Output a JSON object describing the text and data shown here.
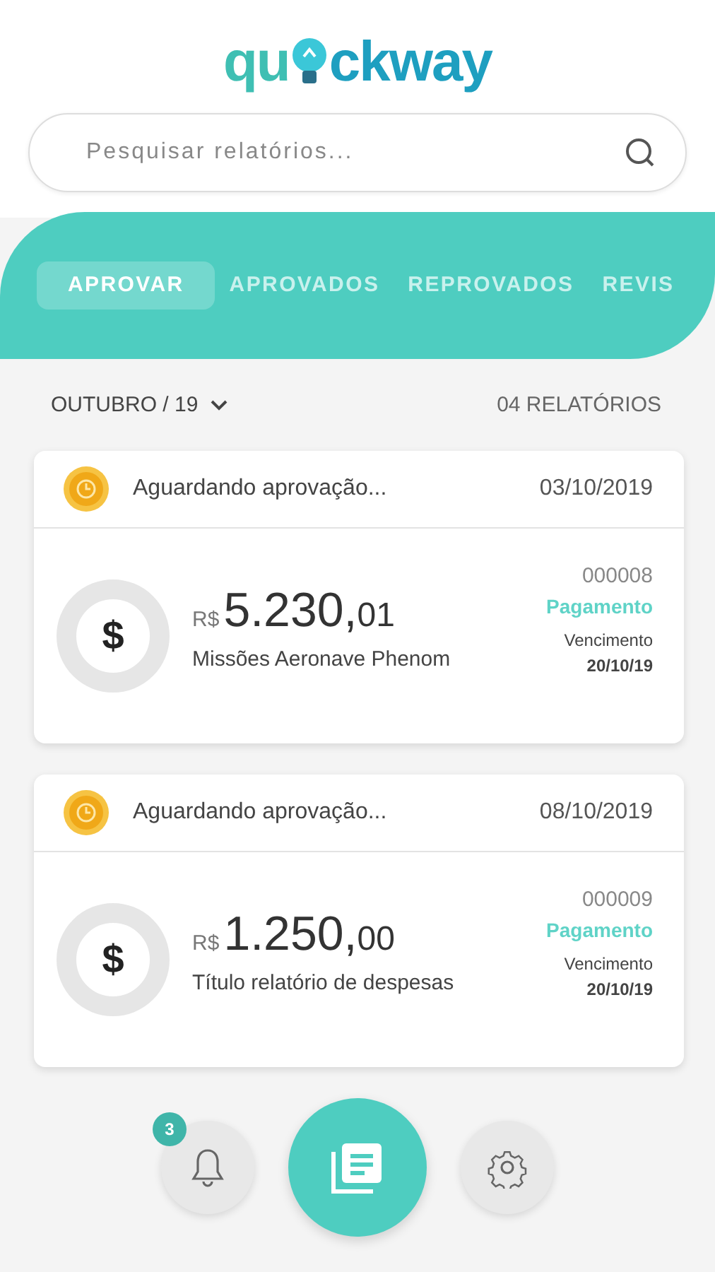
{
  "logo": {
    "before": "qu",
    "after": "ckway"
  },
  "search": {
    "placeholder": "Pesquisar relatórios..."
  },
  "tabs": [
    {
      "label": "APROVAR",
      "selected": true
    },
    {
      "label": "APROVADOS",
      "selected": false
    },
    {
      "label": "REPROVADOS",
      "selected": false
    },
    {
      "label": "REVIS",
      "selected": false
    }
  ],
  "period": "OUTUBRO / 19",
  "count": "04 RELATÓRIOS",
  "reports": [
    {
      "symbol": "$",
      "status": "Aguardando aprovação...",
      "date": "03/10/2019",
      "currency": "R$",
      "amount": "5.230,",
      "cents": "01",
      "title": "Missões Aeronave Phenom",
      "number": "000008",
      "type": "Pagamento",
      "due_label": "Vencimento",
      "due": "20/10/19"
    },
    {
      "symbol": "$",
      "status": "Aguardando aprovação...",
      "date": "08/10/2019",
      "currency": "R$",
      "amount": "1.250,",
      "cents": "00",
      "title": "Título relatório de despesas",
      "number": "000009",
      "type": "Pagamento",
      "due_label": "Vencimento",
      "due": "20/10/19"
    }
  ],
  "nav": {
    "badge": "3"
  }
}
